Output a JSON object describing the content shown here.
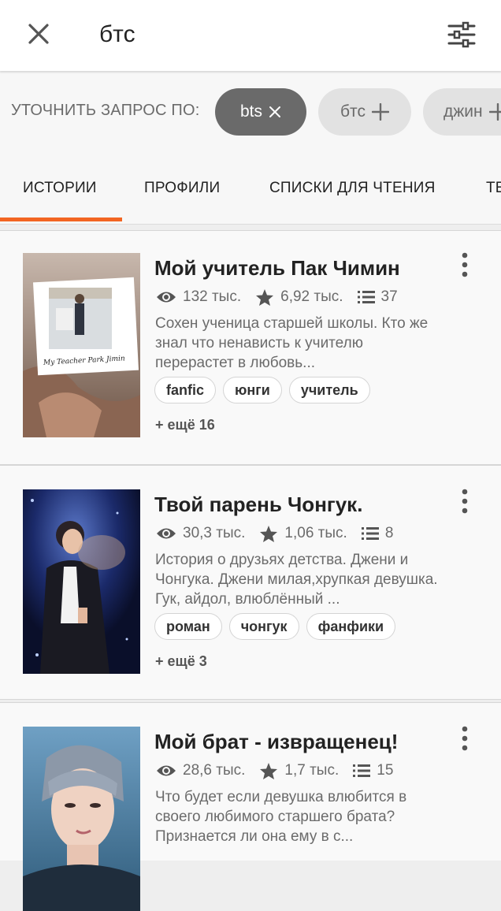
{
  "search": {
    "query": "бтс"
  },
  "refine": {
    "label": "УТОЧНИТЬ ЗАПРОС ПО:",
    "chips": [
      {
        "label": "bts",
        "state": "selected",
        "icon": "close-icon"
      },
      {
        "label": "бтс",
        "state": "add",
        "icon": "plus-icon"
      },
      {
        "label": "джин",
        "state": "add",
        "icon": "plus-icon"
      }
    ]
  },
  "tabs": [
    {
      "label": "ИСТОРИИ",
      "active": true
    },
    {
      "label": "ПРОФИЛИ",
      "active": false
    },
    {
      "label": "СПИСКИ ДЛЯ ЧТЕНИЯ",
      "active": false
    },
    {
      "label": "ТЕ",
      "active": false
    }
  ],
  "stories": [
    {
      "title": "Мой учитель Пак Чимин",
      "reads": "132 тыс.",
      "votes": "6,92 тыс.",
      "parts": "37",
      "description": "Сохен ученица старшей школы. Кто же знал что ненависть к учителю перерастет в любовь...",
      "tags": [
        "fanfic",
        "юнги",
        "учитель"
      ],
      "more_tags": "+ ещё 16",
      "cover_text": "My Teacher Park Jimin"
    },
    {
      "title": "Твой парень Чонгук.",
      "reads": "30,3 тыс.",
      "votes": "1,06 тыс.",
      "parts": "8",
      "description": "История о друзьях детства. Джени и Чонгука. Джени милая,хрупкая девушка. Гук, айдол, влюблённый ...",
      "tags": [
        "роман",
        "чонгук",
        "фанфики"
      ],
      "more_tags": "+ ещё 3"
    },
    {
      "title": "Мой брат - извращенец!",
      "reads": "28,6 тыс.",
      "votes": "1,7 тыс.",
      "parts": "15",
      "description": "Что будет если девушка влюбится в своего любимого старшего брата? Признается ли она ему в с..."
    }
  ],
  "colors": {
    "accent": "#f26522",
    "chip_selected": "#6a6a6a",
    "chip": "#e2e2e2"
  }
}
